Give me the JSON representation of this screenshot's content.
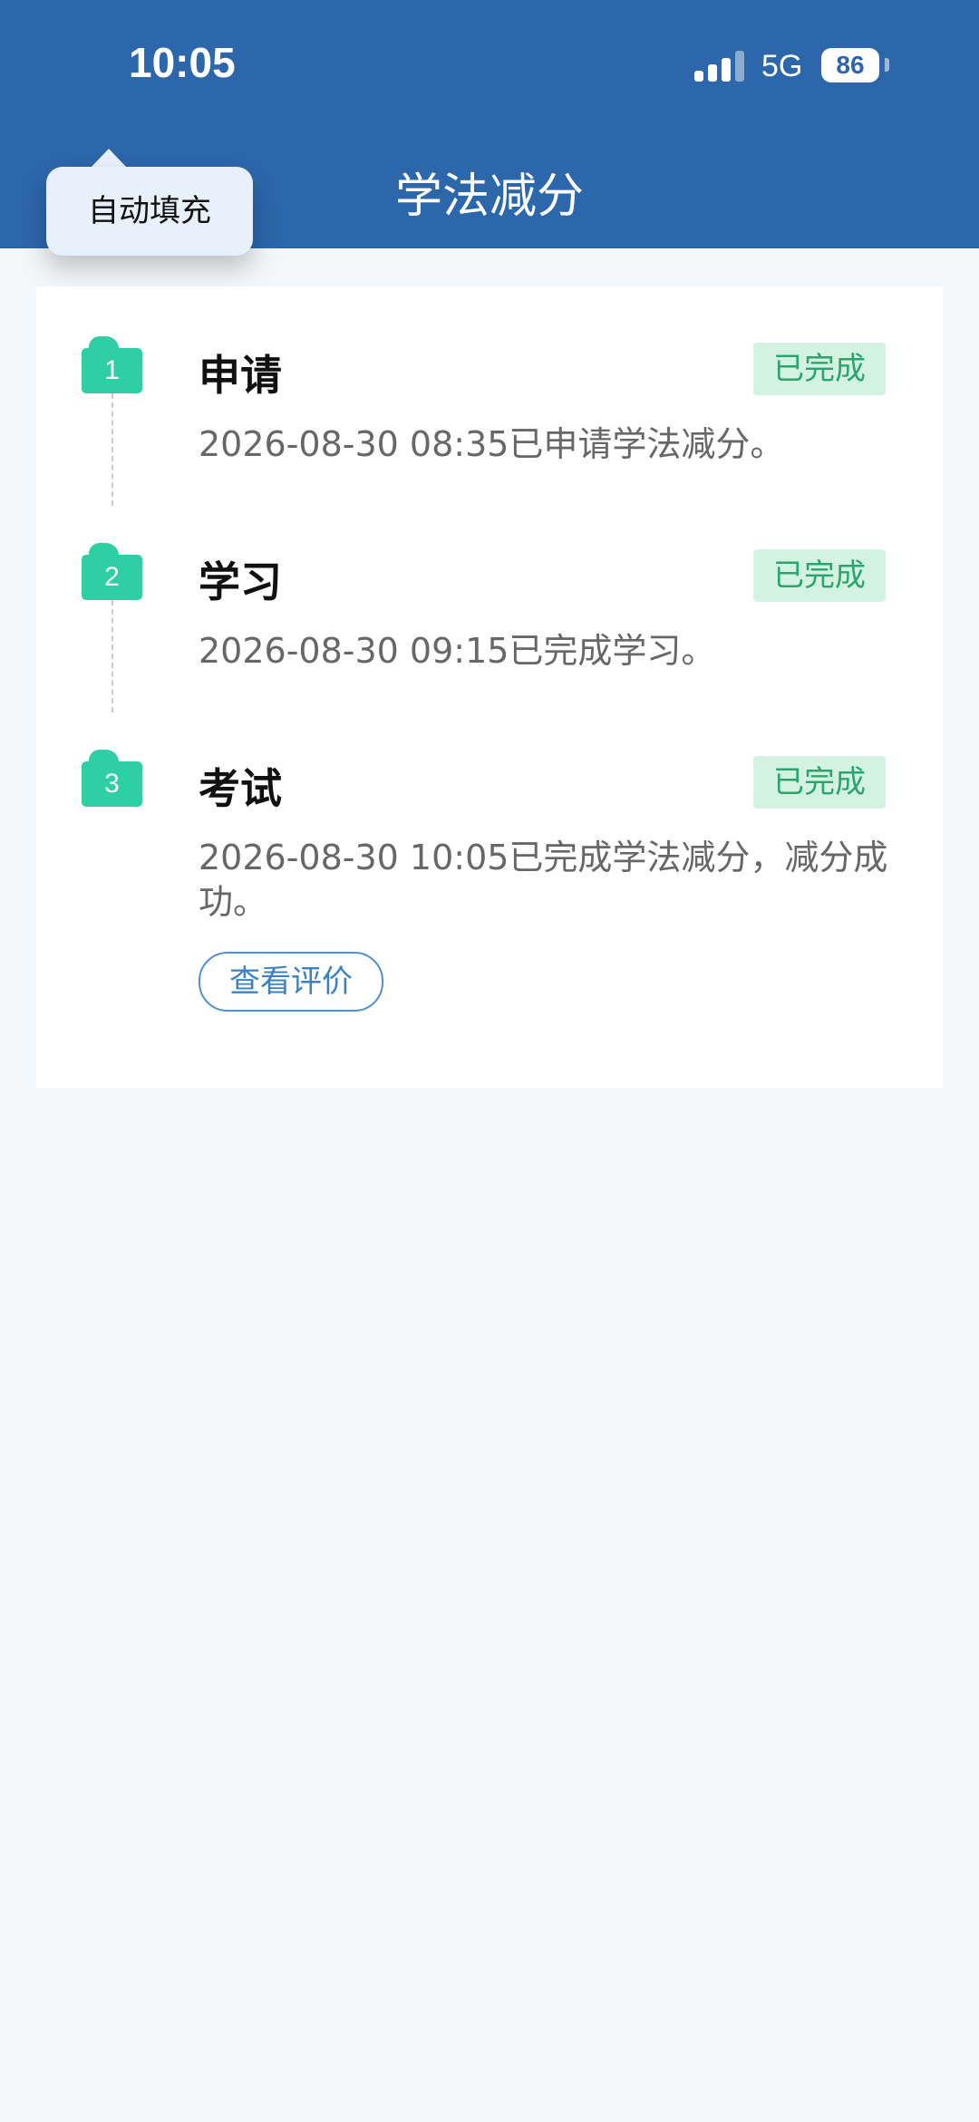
{
  "status_bar": {
    "time": "10:05",
    "network": "5G",
    "battery": "86",
    "battery_level_percent": 86
  },
  "header": {
    "title": "学法减分"
  },
  "autofill": {
    "label": "自动填充"
  },
  "steps": [
    {
      "number": "1",
      "title": "申请",
      "status": "已完成",
      "description": "2026-08-30 08:35已申请学法减分。"
    },
    {
      "number": "2",
      "title": "学习",
      "status": "已完成",
      "description": "2026-08-30 09:15已完成学习。"
    },
    {
      "number": "3",
      "title": "考试",
      "status": "已完成",
      "description": "2026-08-30 10:05已完成学法减分，减分成功。",
      "action_label": "查看评价"
    }
  ],
  "colors": {
    "header_bg": "#2c66ab",
    "step_badge": "#2ecfa4",
    "status_bg": "#d3f2e2",
    "status_text": "#2aa56e",
    "link": "#3a82c4",
    "page_bg": "#f3f7f9"
  },
  "icons": [
    "signal-icon",
    "battery-icon"
  ]
}
